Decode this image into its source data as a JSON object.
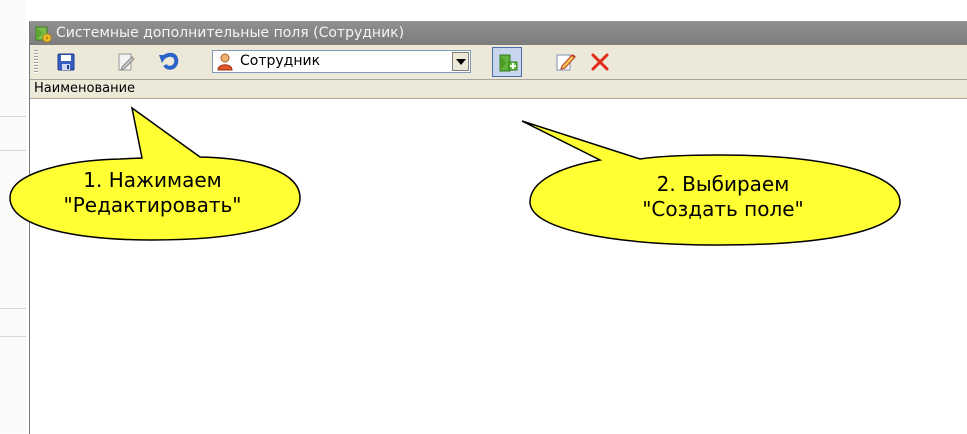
{
  "window": {
    "title": "Системные дополнительные поля (Сотрудник)"
  },
  "toolbar": {
    "buttons": [
      {
        "name": "save",
        "icon": "save-icon"
      },
      {
        "name": "edit",
        "icon": "edit-icon"
      },
      {
        "name": "undo",
        "icon": "undo-icon"
      },
      {
        "name": "create-field",
        "icon": "create-field-icon",
        "pressed": true
      },
      {
        "name": "edit-field",
        "icon": "edit-field-icon"
      },
      {
        "name": "delete",
        "icon": "delete-icon"
      }
    ],
    "entity_select": {
      "value": "Сотрудник",
      "icon": "person-icon"
    }
  },
  "table": {
    "columns": [
      "Наименование"
    ]
  },
  "callouts": [
    {
      "line1": "1. Нажимаем",
      "line2": "\"Редактировать\"",
      "color": "#ffff33"
    },
    {
      "line1": "2. Выбираем",
      "line2": "\"Создать поле\"",
      "color": "#ffff33"
    }
  ]
}
